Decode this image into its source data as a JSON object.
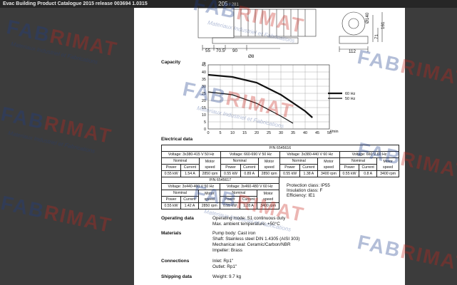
{
  "window": {
    "title": "Evac Building Product Catalogue 2015 release 003694 1.0315",
    "current_page": "205",
    "total_pages": "281"
  },
  "drawing": {
    "dims_bottom": [
      "55",
      "70.5",
      "90",
      "112"
    ],
    "dim_hole": "Ø8",
    "dims_right": [
      "Ø140",
      "71",
      "161"
    ]
  },
  "capacity": {
    "label": "Capacity",
    "y_unit": "m",
    "x_unit": "l/min",
    "legend": [
      {
        "label": "60 Hz",
        "color": "#111111"
      },
      {
        "label": "50 Hz",
        "color": "#111111"
      }
    ]
  },
  "chart_data": {
    "type": "line",
    "xlabel": "l/min",
    "ylabel": "m",
    "xlim": [
      0,
      50
    ],
    "ylim": [
      0,
      45
    ],
    "xticks": [
      "0",
      "5",
      "10",
      "15",
      "20",
      "25",
      "30",
      "35",
      "40",
      "45",
      "50"
    ],
    "yticks": [
      "0",
      "5",
      "10",
      "15",
      "20",
      "25",
      "30",
      "35",
      "40",
      "45"
    ],
    "series": [
      {
        "name": "60 Hz",
        "x": [
          0,
          10,
          20,
          30,
          40,
          43
        ],
        "y": [
          38,
          36.5,
          32.5,
          24,
          12.5,
          8
        ]
      },
      {
        "name": "50 Hz",
        "x": [
          0,
          10,
          20,
          30,
          35
        ],
        "y": [
          26,
          24,
          18,
          9,
          4
        ]
      }
    ]
  },
  "electrical": {
    "label": "Electrical data",
    "table1": {
      "pn": "P/N 6545616",
      "voltages": [
        "Voltage: 3x380-415 V 50 Hz",
        "Voltage: 660-690 V 50 Hz",
        "Voltage: 3x380-440 V 60 Hz",
        "Voltage: 660 V 60 Hz"
      ],
      "nominal": "Nominal",
      "motor_speed": [
        "Motor",
        "speed"
      ],
      "power": "Power",
      "current": "Current",
      "rows": [
        [
          "0.55 kW",
          "1.54 A",
          "2850 rpm"
        ],
        [
          "0.55 kW",
          "0.89 A",
          "2850 rpm"
        ],
        [
          "0.55 kW",
          "1.38 A",
          "3400 rpm"
        ],
        [
          "0.55 kW",
          "0.8 A",
          "3400 rpm"
        ]
      ]
    },
    "table2": {
      "pn": "P/N 6545617",
      "voltages": [
        "Voltage: 3x440-460 V 50 Hz",
        "Voltage: 3x460-480 V 60 Hz"
      ],
      "rows": [
        [
          "0.55 kW",
          "1.42 A",
          "2850 rpm"
        ],
        [
          "0.55 kW",
          "1.28 A",
          "3400 rpm"
        ]
      ]
    },
    "protection": [
      "Protection class: IP55",
      "Insulation class: F",
      "Efficiency: IE1"
    ]
  },
  "operating": {
    "label": "Operating data",
    "lines": [
      "Operating mode: S1 continuous duty",
      "Max. ambient temperature: +50°C"
    ]
  },
  "materials": {
    "label": "Materials",
    "lines": [
      "Pump body: Cast iron",
      "Shaft: Stainless steel DIN 1.4305 (AISI 303)",
      "Mechanical seal: Ceramic/Carbon/NBR",
      "Impeller: Brass"
    ]
  },
  "connections": {
    "label": "Connections",
    "lines": [
      "Inlet: Rp1\"",
      "Outlet: Rp1\""
    ]
  },
  "shipping": {
    "label": "Shipping data",
    "lines": [
      "Weight: 9.7 kg"
    ]
  },
  "watermark": {
    "brand": "FABRIMAT",
    "brand_colors": {
      "fab": "#1d3d8c",
      "rimat": "#c8261c"
    },
    "tagline": "Materiaux Industriel et Fabrications"
  }
}
